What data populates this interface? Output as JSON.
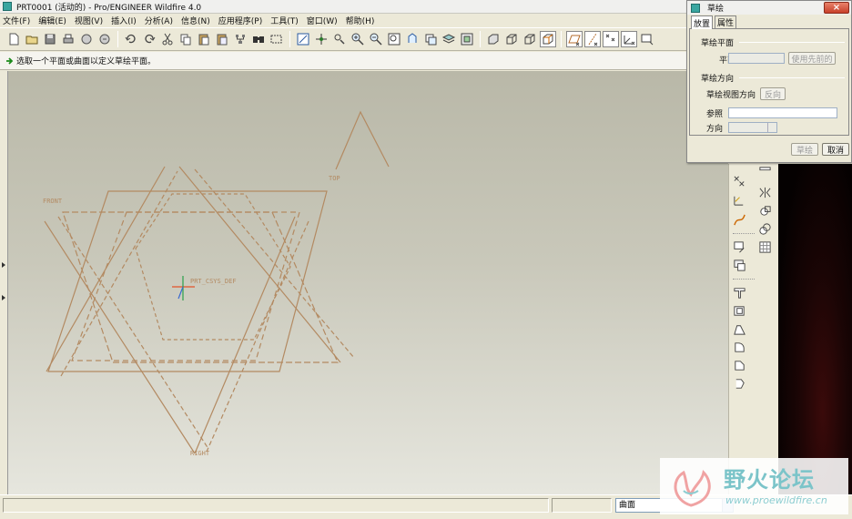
{
  "window": {
    "title": "PRT0001 (活动的) - Pro/ENGINEER Wildfire 4.0"
  },
  "menu": {
    "items": [
      "文件(F)",
      "编辑(E)",
      "视图(V)",
      "插入(I)",
      "分析(A)",
      "信息(N)",
      "应用程序(P)",
      "工具(T)",
      "窗口(W)",
      "帮助(H)"
    ]
  },
  "toolbar": {
    "icons": [
      "new-file",
      "open",
      "save",
      "print",
      "email",
      "email-link",
      "undo",
      "redo",
      "cut",
      "copy",
      "paste",
      "paste-special",
      "regenerate",
      "find",
      "select-box",
      "repaint",
      "spin-center",
      "zoom-in",
      "zoom-out",
      "refit",
      "reorient",
      "saved-views",
      "layers",
      "view-manager",
      "shading",
      "no-hidden",
      "hidden-line",
      "wireframe",
      "datum-planes",
      "datum-axes",
      "datum-points",
      "csys",
      "annotation"
    ]
  },
  "message": {
    "text": "选取一个平面或曲面以定义草绘平面。"
  },
  "graphics": {
    "labels": {
      "csys": "PRT_CSYS_DEF",
      "front": "FRONT",
      "top": "TOP",
      "right": "RIGHT"
    },
    "colors": {
      "datum": "#b38a62",
      "background_top": "#b9b8a8",
      "background_bottom": "#e6e6de"
    }
  },
  "right_toolbar": {
    "icons": [
      "datum-plane-tool",
      "datum-axis-tool",
      "datum-curve-tool",
      "datum-point-tool",
      "datum-csys-tool",
      "sketch-tool",
      "extrude-tool",
      "revolve-tool",
      "sweep-tool",
      "blend-tool",
      "hole-tool",
      "shell-tool",
      "rib-tool",
      "draft-tool",
      "round-tool",
      "chamfer-tool",
      "mirror-tool",
      "merge-tool",
      "pattern-tool"
    ]
  },
  "status": {
    "filter_value": "曲面"
  },
  "watermark": {
    "text": "野火论坛",
    "url": "www.proewildfire.cn"
  },
  "dialog": {
    "title": "草绘",
    "close": "×",
    "tabs": [
      "放置",
      "属性"
    ],
    "sketch_plane_group": "草绘平面",
    "plane_label": "平面",
    "use_previous_button": "使用先前的",
    "orientation_group": "草绘方向",
    "view_direction_label": "草绘视图方向",
    "flip_button": "反向",
    "reference_label": "参照",
    "direction_label": "方向",
    "sketch_button": "草绘",
    "cancel_button": "取消"
  }
}
